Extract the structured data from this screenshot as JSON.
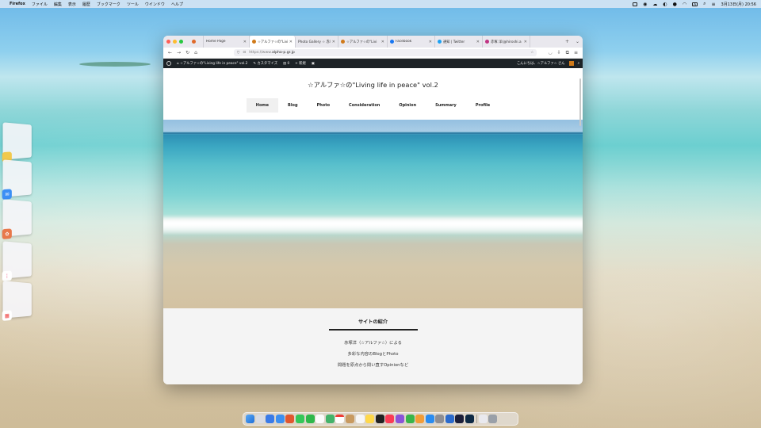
{
  "menubar": {
    "app_name": "Firefox",
    "menus": [
      "ファイル",
      "編集",
      "表示",
      "履歴",
      "ブックマーク",
      "ツール",
      "ウインドウ",
      "ヘルプ"
    ],
    "input_indicator": "A",
    "datetime": "3月13日(月) 20:56"
  },
  "browser": {
    "tabs": [
      {
        "title": "",
        "favicon_color": "#e06a2a",
        "active": false
      },
      {
        "title": "Home Page",
        "favicon_color": "",
        "active": false
      },
      {
        "title": "☆アルファ☆の\"Livi",
        "favicon_color": "#d07a1a",
        "active": true
      },
      {
        "title": "Photo Gallery ☆ 赤じ",
        "favicon_color": "",
        "active": false
      },
      {
        "title": "☆アルファ☆の\"Livi",
        "favicon_color": "#d07a1a",
        "active": false
      },
      {
        "title": "Facebook",
        "favicon_color": "#1877f2",
        "active": false
      },
      {
        "title": "通知 | Twitter",
        "favicon_color": "#1da1f2",
        "active": false
      },
      {
        "title": "赤塚 洋(@hiroshi.a",
        "favicon_color": "#c13584",
        "active": false
      }
    ],
    "new_tab": "+",
    "tab_list": "⌄",
    "url_prefix": "https://www.",
    "url_domain": "alpha-p.gr.jp"
  },
  "wp_admin_bar": {
    "site_name": "☆アルファ☆の\"Living life in peace\" vol.2",
    "customize": "カスタマイズ",
    "comments_count": "0",
    "new": "新規",
    "greeting": "こんにちは、☆アルファ☆ さん"
  },
  "site": {
    "title": "☆アルファ☆の\"Living life in peace\" vol.2",
    "nav": [
      "Home",
      "Blog",
      "Photo",
      "Consideration",
      "Opinion",
      "Summary",
      "Profile"
    ],
    "active_nav": "Home",
    "intro": {
      "heading": "サイトの紹介",
      "lines": [
        "赤塚洋（☆アルファ☆）による",
        "多彩な内容のBlogとPhoto",
        "問題を原点から問い直すOpinionなど"
      ]
    }
  },
  "colors": {
    "wp_bar": "#1d2327",
    "accent_red": "#fe5f57",
    "accent_yellow": "#febc2e",
    "accent_green": "#28c840"
  }
}
